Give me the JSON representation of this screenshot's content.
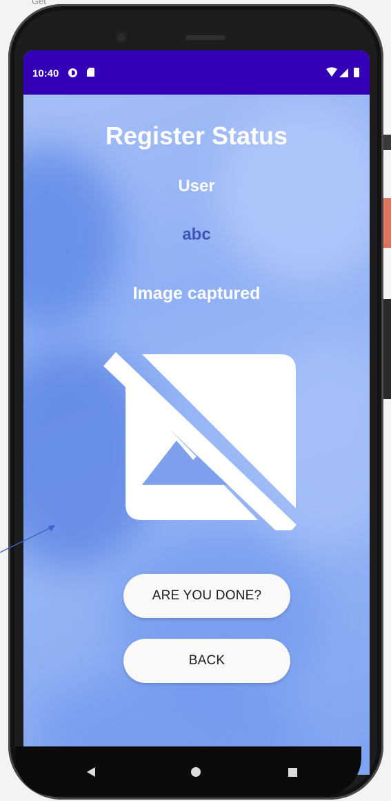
{
  "background": {
    "caption": "Get"
  },
  "status_bar": {
    "time": "10:40",
    "color": "#3400b7",
    "icons": [
      "data-saver-icon",
      "sd-card-icon",
      "wifi-icon",
      "cell-signal-icon",
      "battery-icon"
    ]
  },
  "screen": {
    "title": "Register Status",
    "user_label": "User",
    "user_value": "abc",
    "image_status": "Image captured",
    "image_icon": "hide-image-icon"
  },
  "buttons": {
    "done_label": "ARE YOU DONE?",
    "back_label": "BACK"
  },
  "nav_bar": {
    "icons": [
      "nav-back-icon",
      "nav-home-icon",
      "nav-recents-icon"
    ]
  },
  "colors": {
    "accent_text": "#3d55b4",
    "button_bg": "#fbf8f8",
    "status_bar": "#3400b7"
  }
}
